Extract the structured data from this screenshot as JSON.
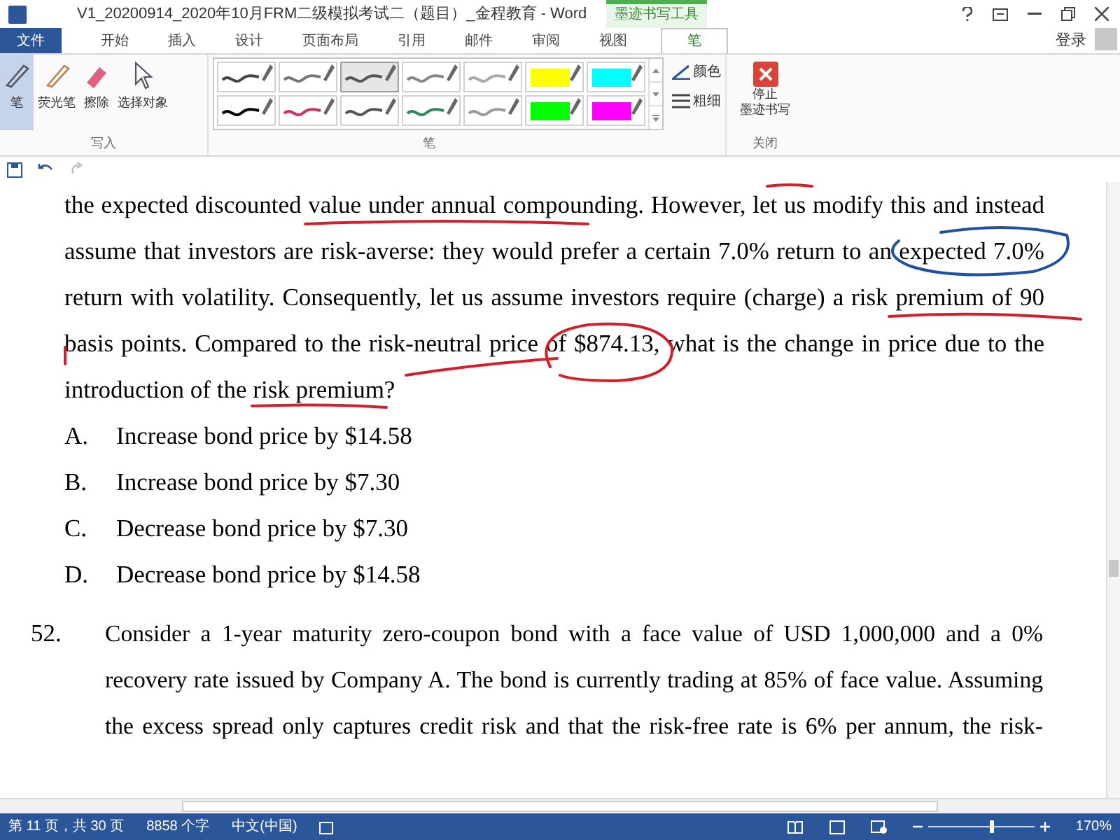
{
  "window": {
    "title": "V1_20200914_2020年10月FRM二级模拟考试二（题目）_金程教育 - Word",
    "context_tab": "墨迹书写工具"
  },
  "tabs": [
    {
      "label": "文件",
      "kind": "file",
      "selected": false
    },
    {
      "label": "开始",
      "kind": "tab",
      "selected": false
    },
    {
      "label": "插入",
      "kind": "tab",
      "selected": false
    },
    {
      "label": "设计",
      "kind": "tab",
      "selected": false
    },
    {
      "label": "页面布局",
      "kind": "tab",
      "selected": false
    },
    {
      "label": "引用",
      "kind": "tab",
      "selected": false
    },
    {
      "label": "邮件",
      "kind": "tab",
      "selected": false
    },
    {
      "label": "审阅",
      "kind": "tab",
      "selected": false
    },
    {
      "label": "视图",
      "kind": "tab",
      "selected": false
    },
    {
      "label": "笔",
      "kind": "tab",
      "selected": true
    }
  ],
  "account": {
    "label": "登录"
  },
  "ribbon": {
    "write_group": {
      "label": "写入",
      "tools": [
        {
          "label": "笔",
          "kind": "pen",
          "selected": true
        },
        {
          "label": "荧光笔",
          "kind": "highlighter",
          "selected": false
        },
        {
          "label": "擦除",
          "kind": "eraser",
          "selected": false
        },
        {
          "label": "选择对象",
          "kind": "select",
          "selected": false
        }
      ]
    },
    "pens_group": {
      "label": "笔",
      "pens": [
        {
          "kind": "pen",
          "color": "#444444",
          "selected": false
        },
        {
          "kind": "pen",
          "color": "#777777",
          "selected": false
        },
        {
          "kind": "pen",
          "color": "#555555",
          "selected": true
        },
        {
          "kind": "pen",
          "color": "#888888",
          "selected": false
        },
        {
          "kind": "pen",
          "color": "#aaaaaa",
          "selected": false
        },
        {
          "kind": "highlighter",
          "color": "#ffff00",
          "selected": false
        },
        {
          "kind": "highlighter",
          "color": "#00ffff",
          "selected": false
        },
        {
          "kind": "pen",
          "color": "#000000",
          "selected": false
        },
        {
          "kind": "pen",
          "color": "#d03060",
          "selected": false
        },
        {
          "kind": "pen",
          "color": "#555555",
          "selected": false
        },
        {
          "kind": "pen",
          "color": "#2e8b57",
          "selected": false
        },
        {
          "kind": "pen",
          "color": "#999999",
          "selected": false
        },
        {
          "kind": "highlighter",
          "color": "#00ff00",
          "selected": false
        },
        {
          "kind": "highlighter",
          "color": "#ff00ff",
          "selected": false
        }
      ],
      "color_label": "颜色",
      "thickness_label": "粗细"
    },
    "close_group": {
      "label": "关闭",
      "button_lines": [
        "停止",
        "墨迹书写"
      ]
    }
  },
  "document": {
    "paragraph_lines": [
      "the expected discounted value under annual compounding. However, let us modify this and instead",
      "assume that investors are risk-averse: they would prefer a certain 7.0% return to an expected 7.0%",
      "return with volatility. Consequently, let us assume investors require (charge) a risk premium of 90",
      "basis points. Compared to the risk-neutral price of $874.13, what is the change in price due to the",
      "introduction of the risk premium?"
    ],
    "options": [
      {
        "letter": "A.",
        "text": "Increase bond price by $14.58"
      },
      {
        "letter": "B.",
        "text": "Increase bond price by $7.30"
      },
      {
        "letter": "C.",
        "text": "Decrease bond price by $7.30"
      },
      {
        "letter": "D.",
        "text": "Decrease bond price by $14.58"
      }
    ],
    "question": {
      "number": "52.",
      "lines": [
        "Consider a 1-year maturity zero-coupon bond with a face value of USD 1,000,000 and a 0%",
        "recovery rate issued by Company A. The bond is currently trading at 85% of face value. Assuming",
        "the excess spread only captures credit risk and that the risk-free rate is 6% per annum, the risk-"
      ]
    }
  },
  "status_bar": {
    "page": "第 11 页，共 30 页",
    "words": "8858 个字",
    "language": "中文(中国)",
    "zoom": {
      "level": 0.59,
      "reading": "170%"
    }
  }
}
